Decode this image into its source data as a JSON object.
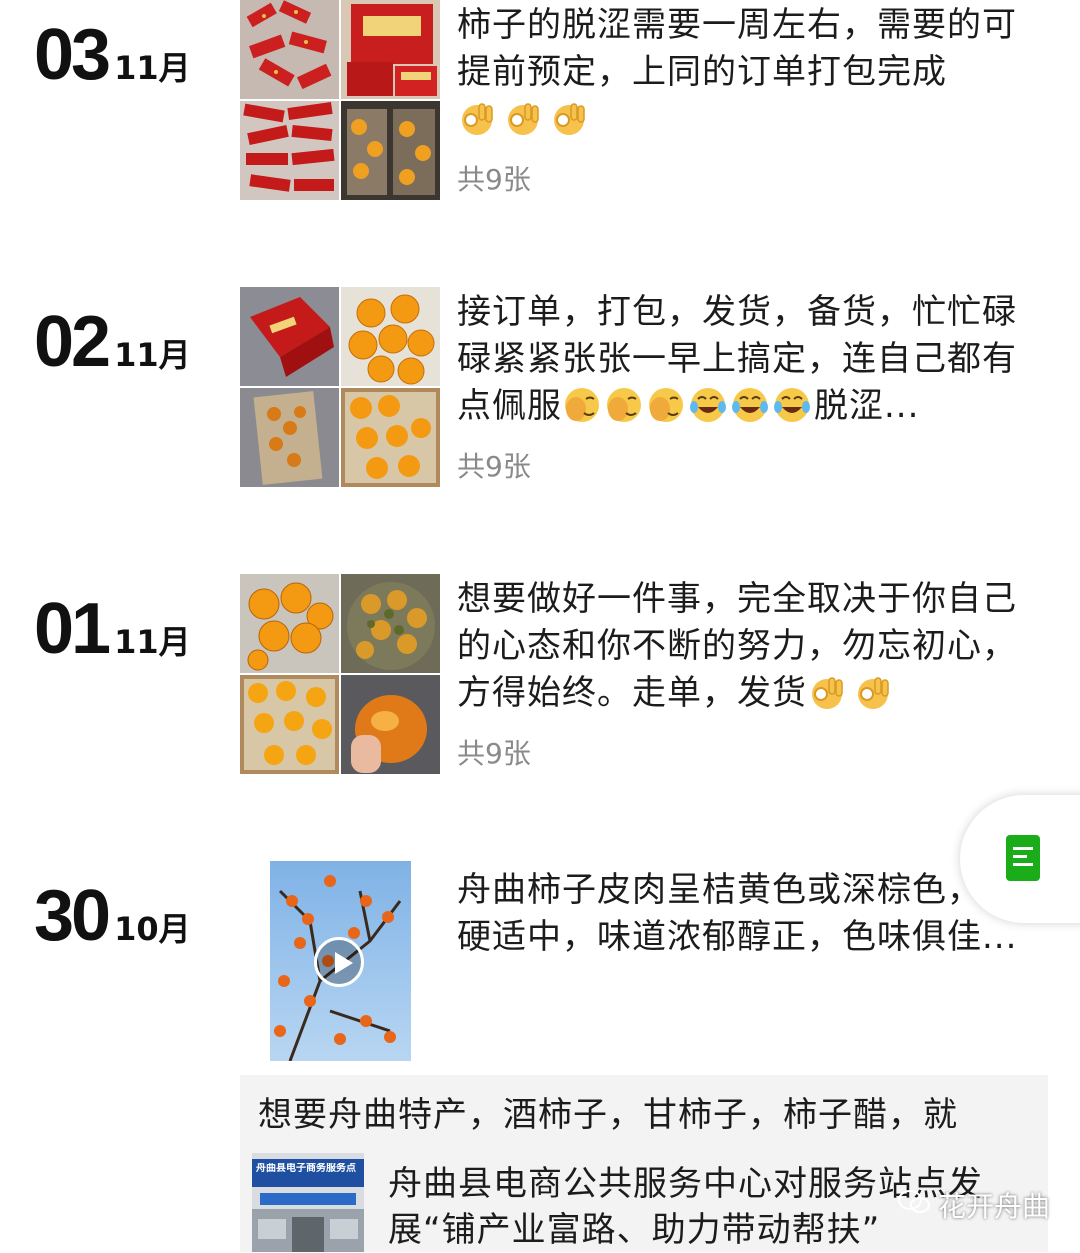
{
  "posts": [
    {
      "day": "03",
      "month": "11月",
      "text": "柿子的脱涩需要一周左右，需要的可提前预定，上同的订单打包完成",
      "emojis": [
        "ok-hand",
        "ok-hand",
        "ok-hand"
      ],
      "count": "共9张"
    },
    {
      "day": "02",
      "month": "11月",
      "text": "接订单，打包，发货，备货，忙忙碌碌紧紧张张一早上搞定，连自己都有点佩服",
      "emojis": [
        "facepalm",
        "facepalm",
        "facepalm",
        "laughing-tears",
        "laughing-tears",
        "laughing-tears"
      ],
      "text_tail": "脱涩...",
      "count": "共9张"
    },
    {
      "day": "01",
      "month": "11月",
      "text": " 想要做好一件事，完全取决于你自己的心态和你不断的努力，勿忘初心，方得始终。走单，发货",
      "emojis": [
        "ok-hand",
        "ok-hand"
      ],
      "count": "共9张"
    },
    {
      "day": "30",
      "month": "10月",
      "text": "舟曲柿子皮肉呈桔黄色或深棕色，软硬适中，味道浓郁醇正，色味俱佳..."
    }
  ],
  "share": {
    "text": "想要舟曲特产，酒柿子，甘柿子，柿子醋，就",
    "title": "舟曲县电商公共服务中心对服务站点发展“铺产业富路、助力带动帮扶”",
    "thumb_sign": "舟曲县电子商务服务点"
  },
  "watermark": "花开舟曲",
  "colors": {
    "accent": "#1aad19",
    "muted": "#8a8a8a",
    "share_bg": "#f3f3f3"
  }
}
